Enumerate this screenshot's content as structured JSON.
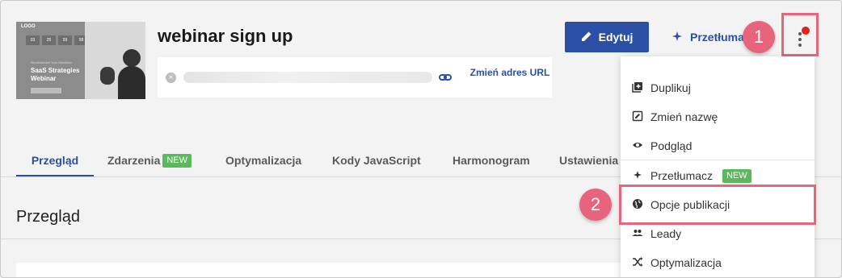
{
  "thumbnail": {
    "logo": "LOGO",
    "counters": [
      "03",
      "25",
      "59",
      "58"
    ],
    "promo": "Revolutionize Your Workflow",
    "title_line1": "SaaS Strategies",
    "title_line2": "Webinar"
  },
  "page": {
    "title": "webinar sign up",
    "change_url_label": "Zmień adres URL"
  },
  "header": {
    "edit_label": "Edytuj",
    "translate_label": "Przetłumacz"
  },
  "steps": {
    "one": "1",
    "two": "2"
  },
  "tabs": [
    {
      "label": "Przegląd"
    },
    {
      "label": "Zdarzenia",
      "badge": "NEW"
    },
    {
      "label": "Optymalizacja"
    },
    {
      "label": "Kody JavaScript"
    },
    {
      "label": "Harmonogram"
    },
    {
      "label": "Ustawienia"
    }
  ],
  "section": {
    "title": "Przegląd"
  },
  "menu": {
    "items": [
      {
        "label": "Duplikuj",
        "icon": "duplicate-icon"
      },
      {
        "label": "Zmień nazwę",
        "icon": "rename-icon"
      },
      {
        "label": "Podgląd",
        "icon": "eye-icon"
      },
      {
        "label": "Przetłumacz",
        "icon": "sparkle-icon",
        "badge": "NEW"
      },
      {
        "label": "Opcje publikacji",
        "icon": "globe-icon"
      },
      {
        "label": "Leady",
        "icon": "people-icon"
      },
      {
        "label": "Optymalizacja",
        "icon": "shuffle-icon"
      }
    ]
  },
  "colors": {
    "primary": "#2a4fa5",
    "accent_highlight": "#e8637c",
    "new_badge": "#5cb85c",
    "notification_dot": "#e32020"
  }
}
